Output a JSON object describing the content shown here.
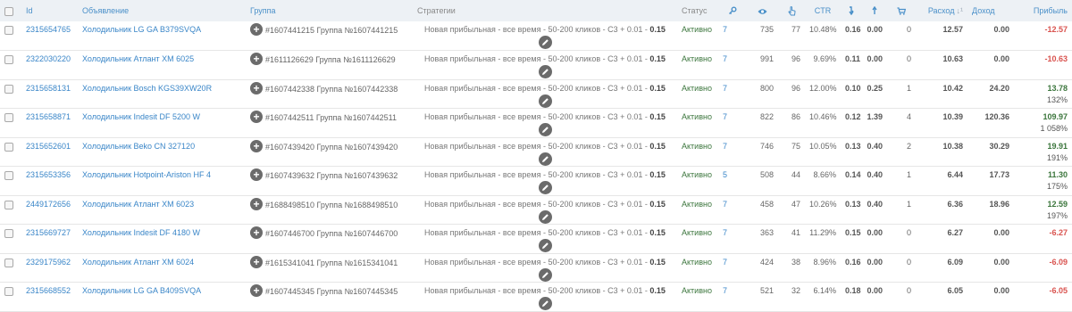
{
  "headers": {
    "id": "Id",
    "ad": "Объявление",
    "group": "Группа",
    "strategy": "Стратегии",
    "status": "Статус",
    "ctr": "CTR",
    "spend": "Расход",
    "income": "Доход",
    "profit": "Прибыль",
    "spend_sort_icon": "sort-amount-icon",
    "keys_icon": "key-icon",
    "views_icon": "eye-icon",
    "clicks_icon": "pointer-icon",
    "price1_icon": "arrow-down-icon",
    "price2_icon": "arrow-up-icon",
    "orders_icon": "cart-icon"
  },
  "colors": {
    "link": "#3a86c8",
    "header_bg": "#edf1f5",
    "positive": "#3c763d",
    "negative": "#d9534f"
  },
  "rows": [
    {
      "id": "2315654765",
      "ad": "Холодильник LG GA B379SVQA",
      "group": "#1607441215 Группа №1607441215",
      "strategy": "Новая прибыльная - все время - 50-200 кликов - C3 + 0.01 - ",
      "strategy_val": "0.15",
      "status": "Активно",
      "keys": "7",
      "views": "735",
      "clicks": "77",
      "ctr": "10.48%",
      "p1": "0.16",
      "p2": "0.00",
      "orders": "0",
      "spend": "12.57",
      "income": "0.00",
      "profit": "-12.57",
      "pct": ""
    },
    {
      "id": "2322030220",
      "ad": "Холодильник Атлант XM 6025",
      "group": "#1611126629 Группа №1611126629",
      "strategy": "Новая прибыльная - все время - 50-200 кликов - C3 + 0.01 - ",
      "strategy_val": "0.15",
      "status": "Активно",
      "keys": "7",
      "views": "991",
      "clicks": "96",
      "ctr": "9.69%",
      "p1": "0.11",
      "p2": "0.00",
      "orders": "0",
      "spend": "10.63",
      "income": "0.00",
      "profit": "-10.63",
      "pct": ""
    },
    {
      "id": "2315658131",
      "ad": "Холодильник Bosch KGS39XW20R",
      "group": "#1607442338 Группа №1607442338",
      "strategy": "Новая прибыльная - все время - 50-200 кликов - C3 + 0.01 - ",
      "strategy_val": "0.15",
      "status": "Активно",
      "keys": "7",
      "views": "800",
      "clicks": "96",
      "ctr": "12.00%",
      "p1": "0.10",
      "p2": "0.25",
      "orders": "1",
      "spend": "10.42",
      "income": "24.20",
      "profit": "13.78",
      "pct": "132%"
    },
    {
      "id": "2315658871",
      "ad": "Холодильник Indesit DF 5200 W",
      "group": "#1607442511 Группа №1607442511",
      "strategy": "Новая прибыльная - все время - 50-200 кликов - C3 + 0.01 - ",
      "strategy_val": "0.15",
      "status": "Активно",
      "keys": "7",
      "views": "822",
      "clicks": "86",
      "ctr": "10.46%",
      "p1": "0.12",
      "p2": "1.39",
      "orders": "4",
      "spend": "10.39",
      "income": "120.36",
      "profit": "109.97",
      "pct": "1 058%"
    },
    {
      "id": "2315652601",
      "ad": "Холодильник Beko CN 327120",
      "group": "#1607439420 Группа №1607439420",
      "strategy": "Новая прибыльная - все время - 50-200 кликов - C3 + 0.01 - ",
      "strategy_val": "0.15",
      "status": "Активно",
      "keys": "7",
      "views": "746",
      "clicks": "75",
      "ctr": "10.05%",
      "p1": "0.13",
      "p2": "0.40",
      "orders": "2",
      "spend": "10.38",
      "income": "30.29",
      "profit": "19.91",
      "pct": "191%"
    },
    {
      "id": "2315653356",
      "ad": "Холодильник Hotpoint-Ariston HF 4",
      "group": "#1607439632 Группа №1607439632",
      "strategy": "Новая прибыльная - все время - 50-200 кликов - C3 + 0.01 - ",
      "strategy_val": "0.15",
      "status": "Активно",
      "keys": "5",
      "views": "508",
      "clicks": "44",
      "ctr": "8.66%",
      "p1": "0.14",
      "p2": "0.40",
      "orders": "1",
      "spend": "6.44",
      "income": "17.73",
      "profit": "11.30",
      "pct": "175%"
    },
    {
      "id": "2449172656",
      "ad": "Холодильник Атлант XM 6023",
      "group": "#1688498510 Группа №1688498510",
      "strategy": "Новая прибыльная - все время - 50-200 кликов - C3 + 0.01 - ",
      "strategy_val": "0.15",
      "status": "Активно",
      "keys": "7",
      "views": "458",
      "clicks": "47",
      "ctr": "10.26%",
      "p1": "0.13",
      "p2": "0.40",
      "orders": "1",
      "spend": "6.36",
      "income": "18.96",
      "profit": "12.59",
      "pct": "197%"
    },
    {
      "id": "2315669727",
      "ad": "Холодильник Indesit DF 4180 W",
      "group": "#1607446700 Группа №1607446700",
      "strategy": "Новая прибыльная - все время - 50-200 кликов - C3 + 0.01 - ",
      "strategy_val": "0.15",
      "status": "Активно",
      "keys": "7",
      "views": "363",
      "clicks": "41",
      "ctr": "11.29%",
      "p1": "0.15",
      "p2": "0.00",
      "orders": "0",
      "spend": "6.27",
      "income": "0.00",
      "profit": "-6.27",
      "pct": ""
    },
    {
      "id": "2329175962",
      "ad": "Холодильник Атлант XM 6024",
      "group": "#1615341041 Группа №1615341041",
      "strategy": "Новая прибыльная - все время - 50-200 кликов - C3 + 0.01 - ",
      "strategy_val": "0.15",
      "status": "Активно",
      "keys": "7",
      "views": "424",
      "clicks": "38",
      "ctr": "8.96%",
      "p1": "0.16",
      "p2": "0.00",
      "orders": "0",
      "spend": "6.09",
      "income": "0.00",
      "profit": "-6.09",
      "pct": ""
    },
    {
      "id": "2315668552",
      "ad": "Холодильник LG GA B409SVQA",
      "group": "#1607445345 Группа №1607445345",
      "strategy": "Новая прибыльная - все время - 50-200 кликов - C3 + 0.01 - ",
      "strategy_val": "0.15",
      "status": "Активно",
      "keys": "7",
      "views": "521",
      "clicks": "32",
      "ctr": "6.14%",
      "p1": "0.18",
      "p2": "0.00",
      "orders": "0",
      "spend": "6.05",
      "income": "0.00",
      "profit": "-6.05",
      "pct": ""
    }
  ]
}
